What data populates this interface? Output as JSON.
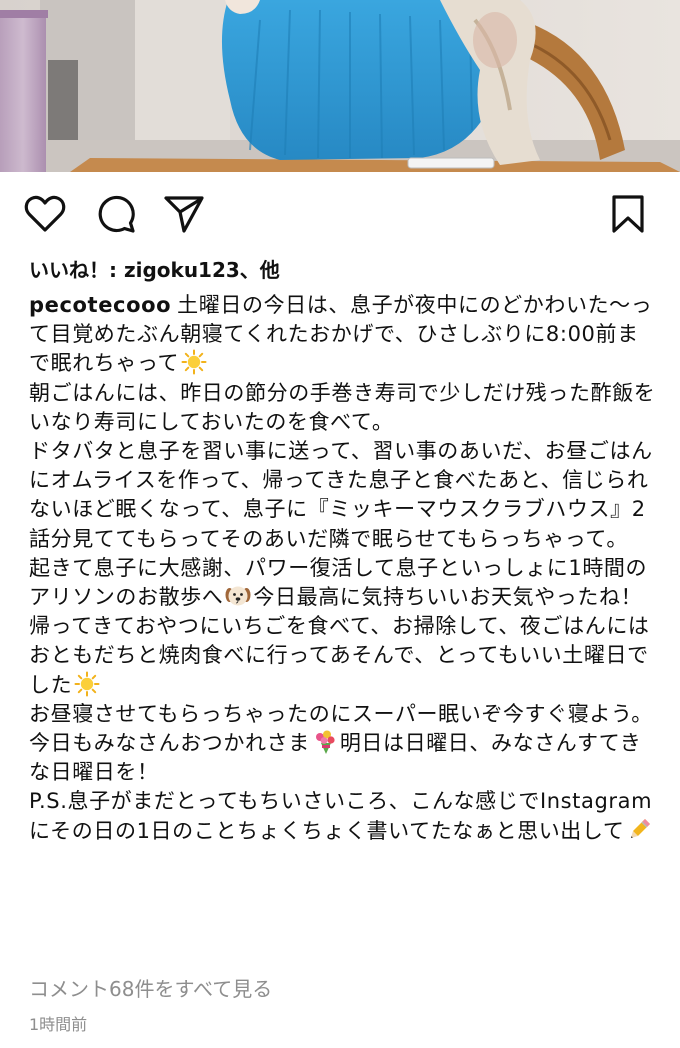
{
  "post": {
    "likes_text": "いいね！: zigoku123、他",
    "caption": {
      "username": "pecotecooo",
      "paragraphs": [
        {
          "text": "土曜日の今日は、息子が夜中にのどかわいた〜って目覚めたぶん朝寝てくれたおかげで、ひさしぶりに8:00前まで眠れちゃって",
          "emoji_after": "sun-emoji"
        },
        {
          "text": "朝ごはんには、昨日の節分の手巻き寿司で少しだけ残った酢飯をいなり寿司にしておいたのを食べて。"
        },
        {
          "text": "ドタバタと息子を習い事に送って、習い事のあいだ、お昼ごはんにオムライスを作って、帰ってきた息子と食べたあと、信じられないほど眠くなって、息子に『ミッキーマウスクラブハウス』2話分見ててもらってそのあいだ隣で眠らせてもらっちゃって。"
        },
        {
          "text_before": "起きて息子に大感謝、パワー復活して息子といっしょに1時間のアリソンのお散歩へ",
          "emoji_mid": "dog-face-emoji",
          "text_after": "今日最高に気持ちいいお天気やったね！"
        },
        {
          "text": "帰ってきておやつにいちごを食べて、お掃除して、夜ごはんにはおともだちと焼肉食べに行ってあそんで、とってもいい土曜日でした",
          "emoji_after": "sun-emoji"
        },
        {
          "text": "お昼寝させてもらっちゃったのにスーパー眠いぞ今すぐ寝よう。"
        },
        {
          "text_before": "今日もみなさんおつかれさま",
          "emoji_mid": "bouquet-emoji",
          "text_after": "明日は日曜日、みなさんすてきな日曜日を！"
        },
        {
          "text": "P.S.息子がまだとってもちいさいころ、こんな感じでInstagramにその日の1日のことちょくちょく書いてたなぁと思い出して",
          "emoji_after": "pencil-emoji"
        }
      ]
    },
    "comments_link": "コメント68件をすべて見る",
    "timestamp": "1時間前"
  },
  "actions": {
    "like": "heart-icon",
    "comment": "comment-bubble-icon",
    "share": "paper-plane-icon",
    "save": "bookmark-icon"
  },
  "colors": {
    "text": "#111111",
    "muted": "#8e8e8e",
    "sweater": "#2f9bd6"
  }
}
